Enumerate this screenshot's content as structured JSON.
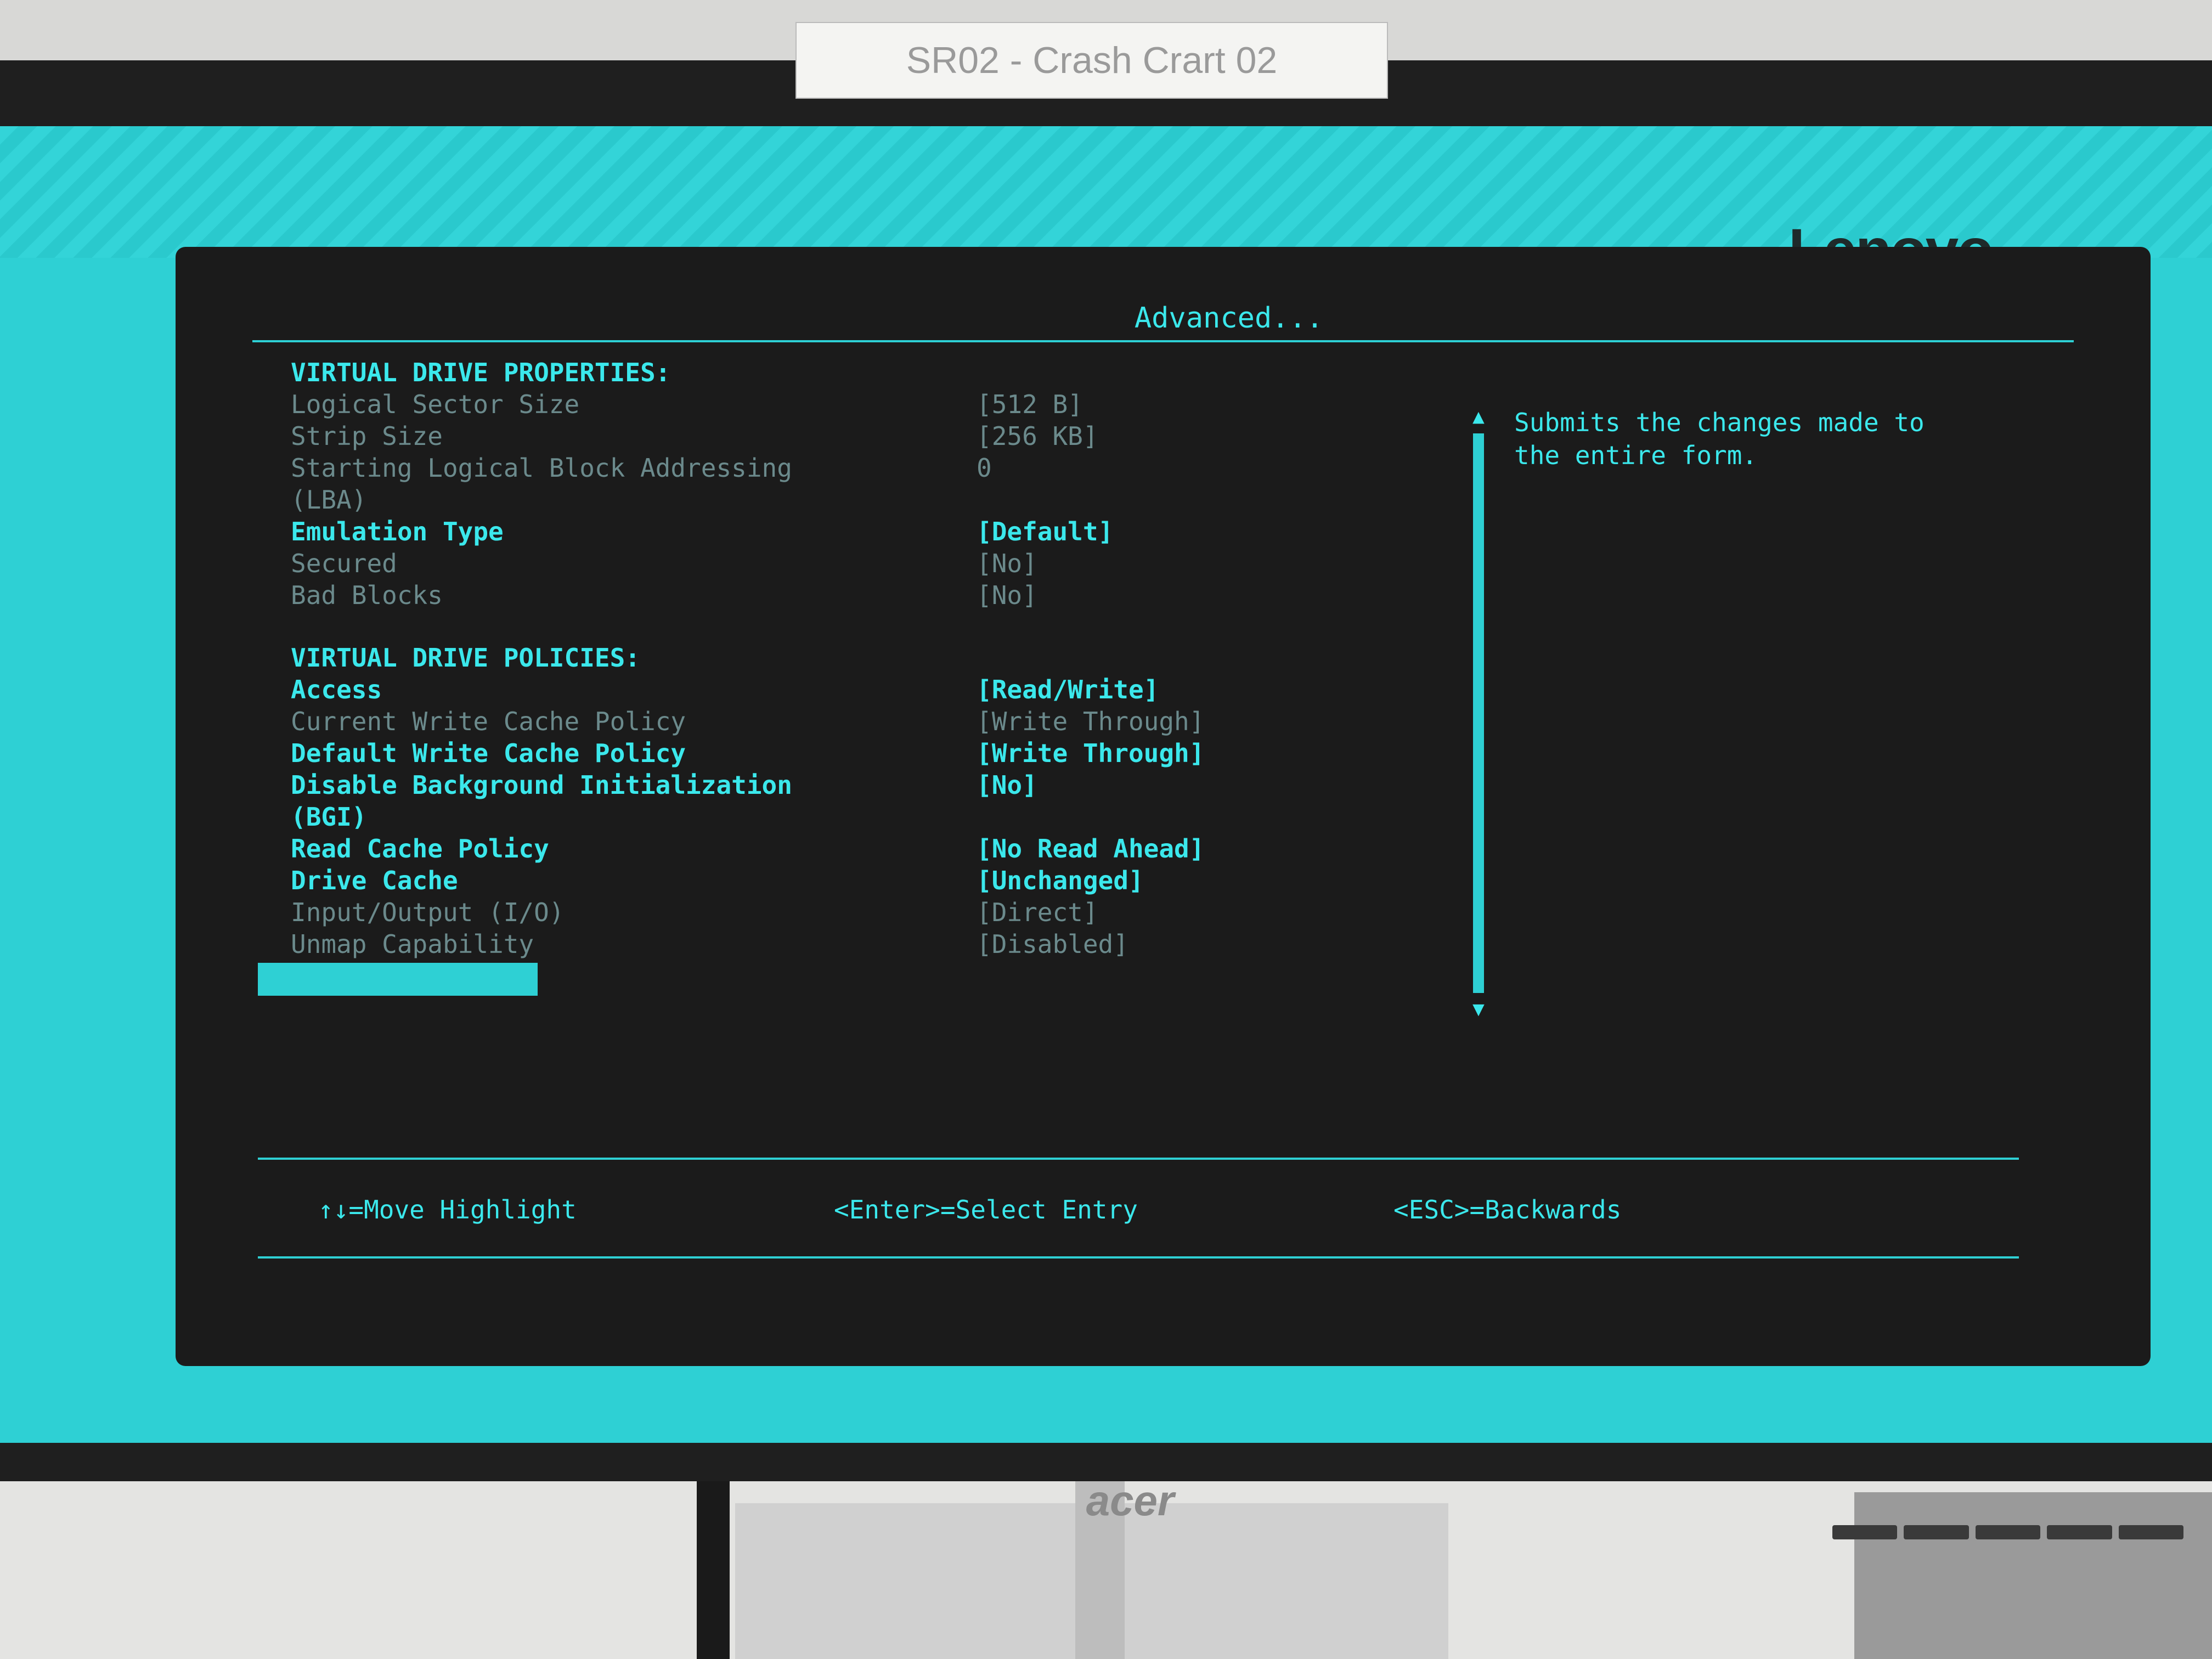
{
  "label_tag": "SR02 - Crash Crart 02",
  "monitor_brand": "acer",
  "screen_brand": "Lenovo",
  "panel": {
    "title": "Advanced...",
    "properties_heading": "VIRTUAL DRIVE PROPERTIES:",
    "properties": [
      {
        "label": "Logical Sector Size",
        "value": "[512 B]"
      },
      {
        "label": "Strip Size",
        "value": "[256 KB]"
      },
      {
        "label": "Starting Logical Block Addressing",
        "value": "0"
      },
      {
        "label": "(LBA)",
        "value": ""
      },
      {
        "label": "Emulation Type",
        "value": "[Default]"
      },
      {
        "label": "Secured",
        "value": "[No]"
      },
      {
        "label": "Bad Blocks",
        "value": "[No]"
      }
    ],
    "policies_heading": "VIRTUAL DRIVE POLICIES:",
    "policies": [
      {
        "label": "Access",
        "value": "[Read/Write]"
      },
      {
        "label": "Current Write Cache Policy",
        "value": "[Write Through]"
      },
      {
        "label": "Default Write Cache Policy",
        "value": "[Write Through]"
      },
      {
        "label": "Disable Background Initialization",
        "value": "[No]"
      },
      {
        "label": "(BGI)",
        "value": ""
      },
      {
        "label": "Read Cache Policy",
        "value": "[No Read Ahead]"
      },
      {
        "label": "Drive Cache",
        "value": "[Unchanged]"
      },
      {
        "label": "Input/Output (I/O)",
        "value": "[Direct]"
      },
      {
        "label": "Unmap Capability",
        "value": "[Disabled]"
      }
    ],
    "help_line1": "Submits the changes made to",
    "help_line2": "the entire form.",
    "footer": {
      "move": "↑↓=Move Highlight",
      "select": "<Enter>=Select Entry",
      "back": "<ESC>=Backwards"
    }
  }
}
